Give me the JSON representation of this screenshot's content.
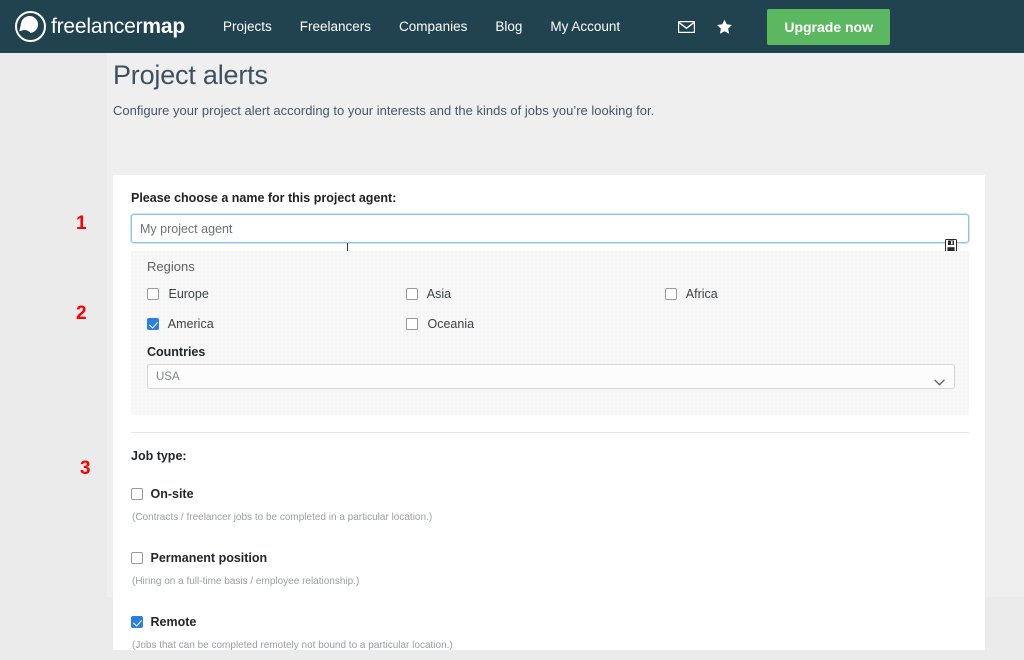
{
  "header": {
    "brand": {
      "light": "freelancer",
      "bold": "map",
      "logo_icon": "freelancermap-circle-logo"
    },
    "nav": [
      {
        "label": "Projects"
      },
      {
        "label": "Freelancers"
      },
      {
        "label": "Companies"
      },
      {
        "label": "Blog"
      },
      {
        "label": "My Account"
      }
    ],
    "messages_icon": "envelope-icon",
    "favorites_icon": "star-icon",
    "upgrade_label": "Upgrade now",
    "bg_color": "#214350",
    "upgrade_color": "#5cb860"
  },
  "page": {
    "title": "Project alerts",
    "subtitle": "Configure your project alert according to your interests and the kinds of jobs you’re looking for."
  },
  "annotations": [
    {
      "number": "1"
    },
    {
      "number": "2"
    },
    {
      "number": "3"
    }
  ],
  "name_section": {
    "label": "Please choose a name for this project agent:",
    "value": "My project agent",
    "placeholder": "My project agent",
    "save_icon": "floppy-disk-save-icon"
  },
  "regions": {
    "title": "Regions",
    "columns": [
      [
        {
          "label": "Europe",
          "checked": false
        },
        {
          "label": "America",
          "checked": true
        }
      ],
      [
        {
          "label": "Asia",
          "checked": false
        },
        {
          "label": "Oceania",
          "checked": false
        }
      ],
      [
        {
          "label": "Africa",
          "checked": false
        }
      ]
    ],
    "countries_label": "Countries",
    "countries_selected": "USA",
    "countries_options": [
      "USA"
    ]
  },
  "job_type": {
    "title": "Job type:",
    "items": [
      {
        "label": "On-site",
        "checked": false,
        "description": "(Contracts / freelancer jobs to be completed in a particular location.)"
      },
      {
        "label": "Permanent position",
        "checked": false,
        "description": "(Hiring on a full-time basis / employee relationship.)"
      },
      {
        "label": "Remote",
        "checked": true,
        "description": "(Jobs that can be completed remotely not bound to a particular location.)"
      }
    ]
  }
}
